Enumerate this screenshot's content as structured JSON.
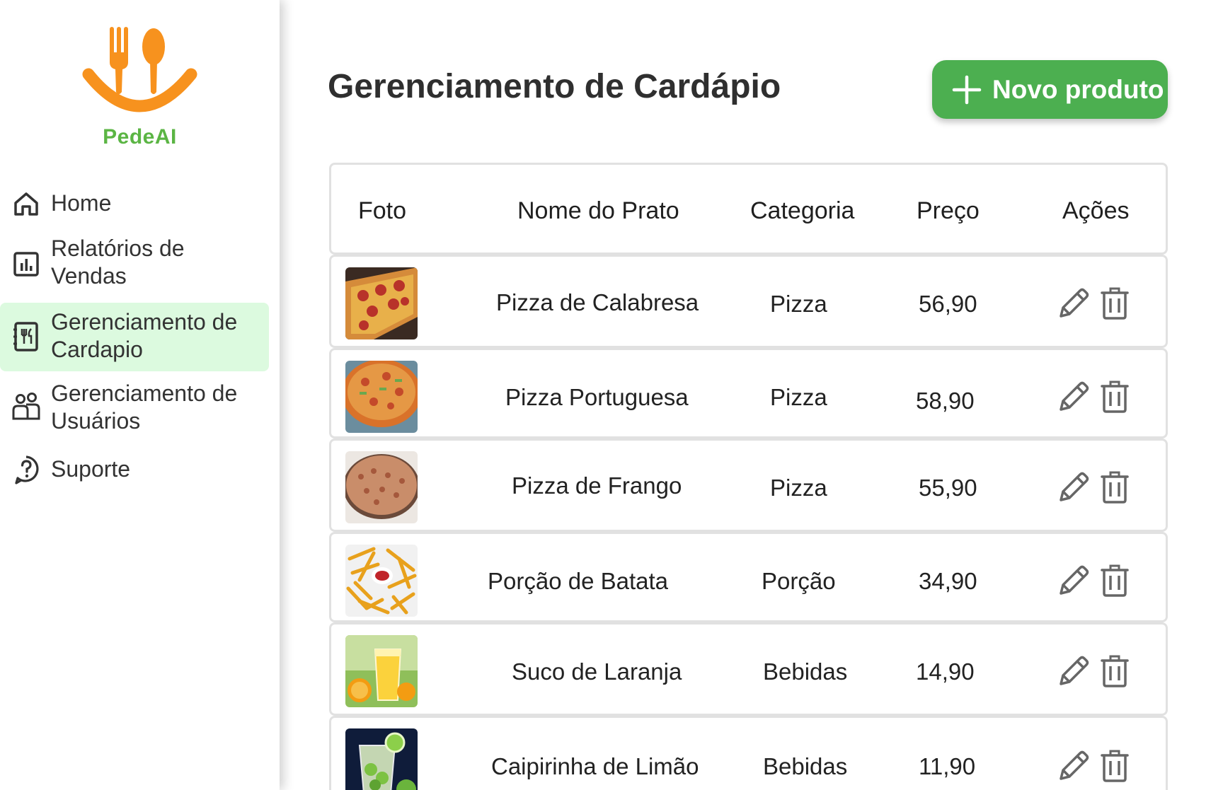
{
  "app": {
    "brand": "PedeAI"
  },
  "sidebar": {
    "items": [
      {
        "label": "Home",
        "icon": "home-icon"
      },
      {
        "label": "Relatórios de Vendas",
        "icon": "bar-chart-icon"
      },
      {
        "label": "Gerenciamento de Cardapio",
        "icon": "menu-book-icon",
        "active": true
      },
      {
        "label": "Gerenciamento de Usuários",
        "icon": "users-icon"
      },
      {
        "label": "Suporte",
        "icon": "help-circle-icon"
      }
    ]
  },
  "main": {
    "title": "Gerenciamento de Cardápio",
    "new_button_label": "Novo produto"
  },
  "table": {
    "headers": {
      "foto": "Foto",
      "nome": "Nome do Prato",
      "categoria": "Categoria",
      "preco": "Preço",
      "acoes": "Ações"
    },
    "rows": [
      {
        "nome": "Pizza de Calabresa",
        "categoria": "Pizza",
        "preco": "56,90",
        "photo": "pizza-calabresa-photo"
      },
      {
        "nome": "Pizza Portuguesa",
        "categoria": "Pizza",
        "preco": "58,90",
        "photo": "pizza-portuguesa-photo"
      },
      {
        "nome": "Pizza de Frango",
        "categoria": "Pizza",
        "preco": "55,90",
        "photo": "pizza-frango-photo"
      },
      {
        "nome": "Porção de Batata",
        "categoria": "Porção",
        "preco": "34,90",
        "photo": "batata-frita-photo"
      },
      {
        "nome": "Suco de Laranja",
        "categoria": "Bebidas",
        "preco": "14,90",
        "photo": "suco-laranja-photo"
      },
      {
        "nome": "Caipirinha de Limão",
        "categoria": "Bebidas",
        "preco": "11,90",
        "photo": "caipirinha-photo"
      }
    ]
  },
  "colors": {
    "accent_green": "#4caf50",
    "brand_orange": "#f7921e",
    "brand_green": "#5bb544",
    "active_nav_bg": "#dcfadf"
  }
}
